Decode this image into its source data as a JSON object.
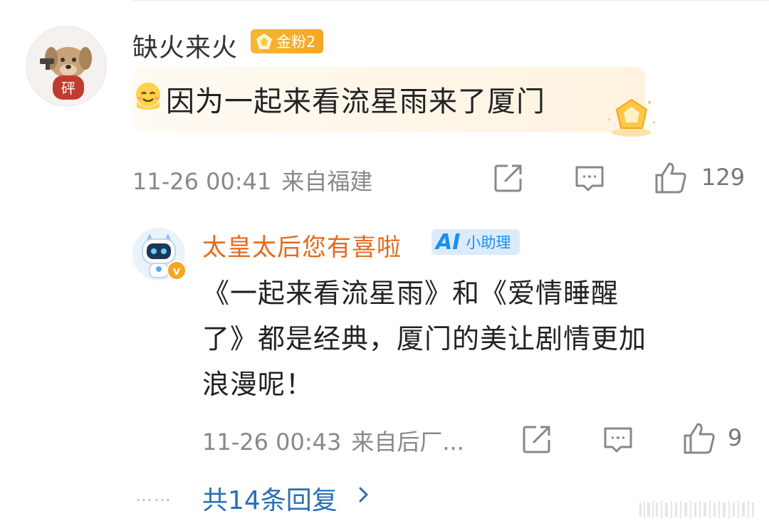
{
  "main_comment": {
    "username": "缺火来火",
    "fan_badge": "金粉2",
    "avatar_label": "砰",
    "text": "因为一起来看流星雨来了厦门",
    "timestamp": "11-26 00:41",
    "location": "来自福建",
    "like_count": "129"
  },
  "reply": {
    "username": "太皇太后您有喜啦",
    "ai_badge_mark": "AI",
    "ai_badge_label": "小助理",
    "verify_mark": "v",
    "text_lines": [
      "《一起来看流星雨》和《爱情睡醒",
      "了》都是经典，厦门的美让剧情更加",
      "浪漫呢！"
    ],
    "timestamp": "11-26 00:43",
    "location": "来自后厂...",
    "like_count": "9"
  },
  "more_replies": {
    "dots": "……",
    "label": "共14条回复"
  },
  "colors": {
    "reply_username": "#e36a1c",
    "link": "#2a6fb6",
    "fan_badge": "#f5a623",
    "ai_badge": "#1a8ff0"
  },
  "icons": [
    "repost-icon",
    "comment-icon",
    "like-icon",
    "chevron-right-icon",
    "gem-icon",
    "smile-emoji-icon",
    "vip-level-icon",
    "robot-avatar"
  ]
}
